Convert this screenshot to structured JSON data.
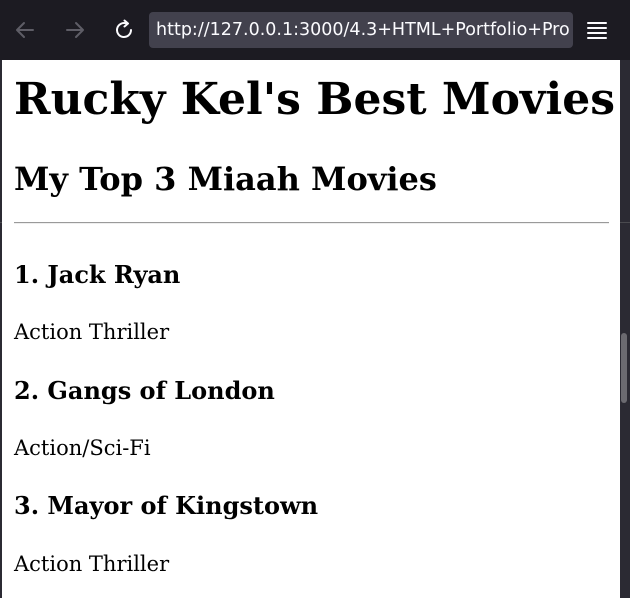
{
  "browser": {
    "url": "http://127.0.0.1:3000/4.3+HTML+Portfolio+Pro",
    "back_icon": "arrow-left-icon",
    "forward_icon": "arrow-right-icon",
    "reload_icon": "reload-icon",
    "menu_icon": "hamburger-menu-icon"
  },
  "page": {
    "title": "Rucky Kel's Best Movies",
    "subtitle": "My Top 3 Miaah Movies",
    "movies": [
      {
        "title": "1. Jack Ryan",
        "genre": "Action Thriller"
      },
      {
        "title": "2. Gangs of London",
        "genre": "Action/Sci-Fi"
      },
      {
        "title": "3. Mayor of Kingstown",
        "genre": "Action Thriller"
      }
    ]
  },
  "colors": {
    "toolbar_bg": "#1c1b22",
    "urlbar_bg": "#42414d",
    "page_bg": "#ffffff"
  }
}
